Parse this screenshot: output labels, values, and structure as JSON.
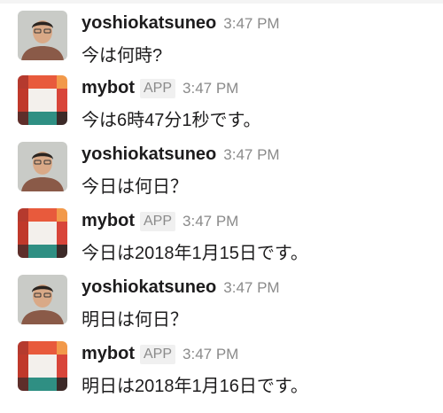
{
  "messages": [
    {
      "kind": "user",
      "name": "yoshiokatsuneo",
      "time": "3:47 PM",
      "text": "今は何時?"
    },
    {
      "kind": "bot",
      "name": "mybot",
      "badge": "APP",
      "time": "3:47 PM",
      "text": "今は6時47分1秒です。"
    },
    {
      "kind": "user",
      "name": "yoshiokatsuneo",
      "time": "3:47 PM",
      "text": "今日は何日？"
    },
    {
      "kind": "bot",
      "name": "mybot",
      "badge": "APP",
      "time": "3:47 PM",
      "text": "今日は2018年1月15日です。"
    },
    {
      "kind": "user",
      "name": "yoshiokatsuneo",
      "time": "3:47 PM",
      "text": "明日は何日？"
    },
    {
      "kind": "bot",
      "name": "mybot",
      "badge": "APP",
      "time": "3:47 PM",
      "text": "明日は2018年1月16日です。"
    }
  ],
  "colors": {
    "bot_tl": "#b53a2e",
    "bot_top": "#e85a3c",
    "bot_tr": "#f2994a",
    "bot_left": "#c0392b",
    "bot_center": "#f3f0ec",
    "bot_right": "#d8453a",
    "bot_bl": "#5e2e2a",
    "bot_bottom": "#2f8f83",
    "bot_br": "#3c2a28"
  }
}
